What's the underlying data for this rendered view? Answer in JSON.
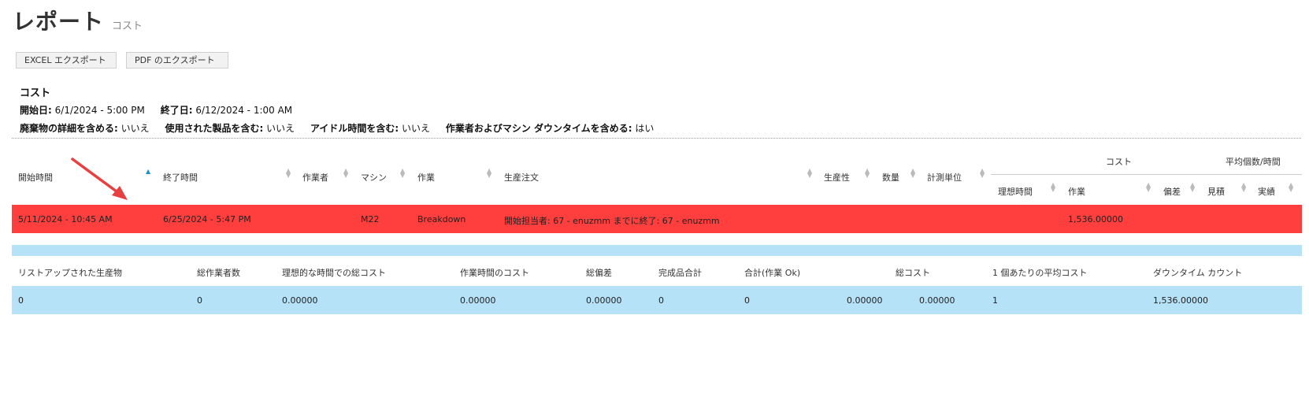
{
  "page": {
    "title": "レポート",
    "subtitle": "コスト"
  },
  "toolbar": {
    "excel_label": "EXCEL エクスポート",
    "pdf_label": "PDF のエクスポート"
  },
  "report_info": {
    "name": "コスト",
    "start_label": "開始日:",
    "start_value": "6/1/2024 - 5:00 PM",
    "end_label": "終了日:",
    "end_value": "6/12/2024 - 1:00 AM",
    "options": [
      {
        "label": "廃棄物の詳細を含める:",
        "value": "いいえ"
      },
      {
        "label": "使用された製品を含む:",
        "value": "いいえ"
      },
      {
        "label": "アイドル時間を含む:",
        "value": "いいえ"
      },
      {
        "label": "作業者およびマシン ダウンタイムを含める:",
        "value": "はい"
      }
    ]
  },
  "table": {
    "group_headers": {
      "cost": "コスト",
      "avg_per_hour": "平均個数/時間"
    },
    "columns": {
      "start_time": "開始時間",
      "end_time": "終了時間",
      "worker": "作業者",
      "machine": "マシン",
      "job": "作業",
      "production_order": "生産注文",
      "productivity": "生産性",
      "quantity": "数量",
      "unit": "計測単位",
      "ideal_time": "理想時間",
      "work": "作業",
      "deviation": "偏差",
      "estimate": "見積",
      "actual": "実績"
    },
    "sorted_column": "start_time",
    "rows": [
      {
        "start_time": "5/11/2024 - 10:45 AM",
        "end_time": "6/25/2024 - 5:47 PM",
        "machine": "M22",
        "job": "Breakdown",
        "production_order": "開始担当者: 67 - enuzmm までに終了: 67 - enuzmm",
        "cost_work": "1,536.00000",
        "row_color": "#ff3e3e"
      }
    ]
  },
  "summary": {
    "headers": [
      "リストアップされた生産物",
      "総作業者数",
      "理想的な時間での総コスト",
      "作業時間のコスト",
      "総偏差",
      "完成品合計",
      "合計(作業 Ok)",
      "総コスト",
      "1 個あたりの平均コスト",
      "ダウンタイム カウント"
    ],
    "values": [
      "0",
      "0",
      "0.00000",
      "0.00000",
      "0.00000",
      "0",
      "0",
      "0.00000",
      "0.00000",
      "1",
      "1,536.00000"
    ],
    "row_color": "#b6e2f8"
  },
  "annotation": {
    "arrow_color": "#e84040"
  }
}
